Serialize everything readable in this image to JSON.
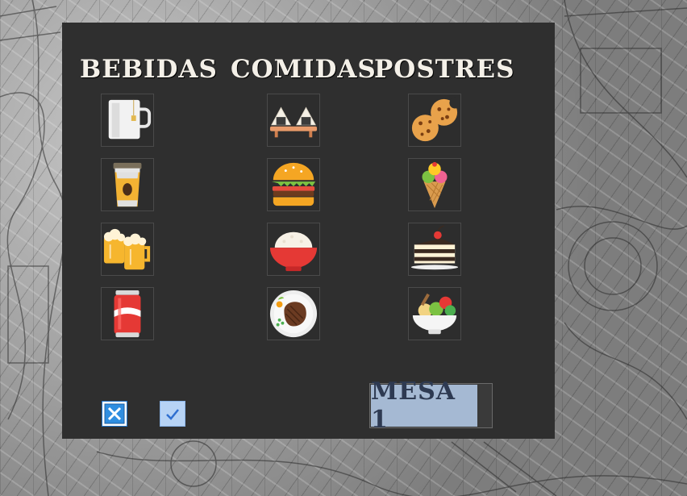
{
  "categories": {
    "bebidas": "BEBIDAS",
    "comidas": "COMIDAS",
    "postres": "POSTRES"
  },
  "items": {
    "bebidas": [
      "tea-cup-icon",
      "coffee-cup-icon",
      "beer-mugs-icon",
      "soda-can-icon"
    ],
    "comidas": [
      "onigiri-icon",
      "burger-icon",
      "rice-bowl-icon",
      "steak-plate-icon"
    ],
    "postres": [
      "cookies-icon",
      "ice-cream-cone-icon",
      "cake-slice-icon",
      "salad-bowl-icon"
    ]
  },
  "actions": {
    "cancel_icon": "close-icon",
    "confirm_icon": "checkmark-icon"
  },
  "table": {
    "label": "MESA 1"
  },
  "colors": {
    "panel": "#2f2f2f",
    "table_button": "#a5b9d3",
    "heading": "#f4f0e8"
  }
}
